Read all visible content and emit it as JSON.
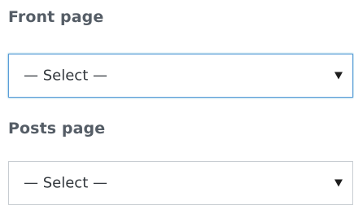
{
  "front_page": {
    "label": "Front page",
    "selected": "— Select —"
  },
  "posts_page": {
    "label": "Posts page",
    "selected": "— Select —"
  },
  "colors": {
    "label_text": "#555d66",
    "focus_border": "#5b9dd9",
    "border": "#c8cdd2",
    "arrow": "#1e1e1e"
  },
  "icons": {
    "dropdown": "triangle-down-icon"
  }
}
